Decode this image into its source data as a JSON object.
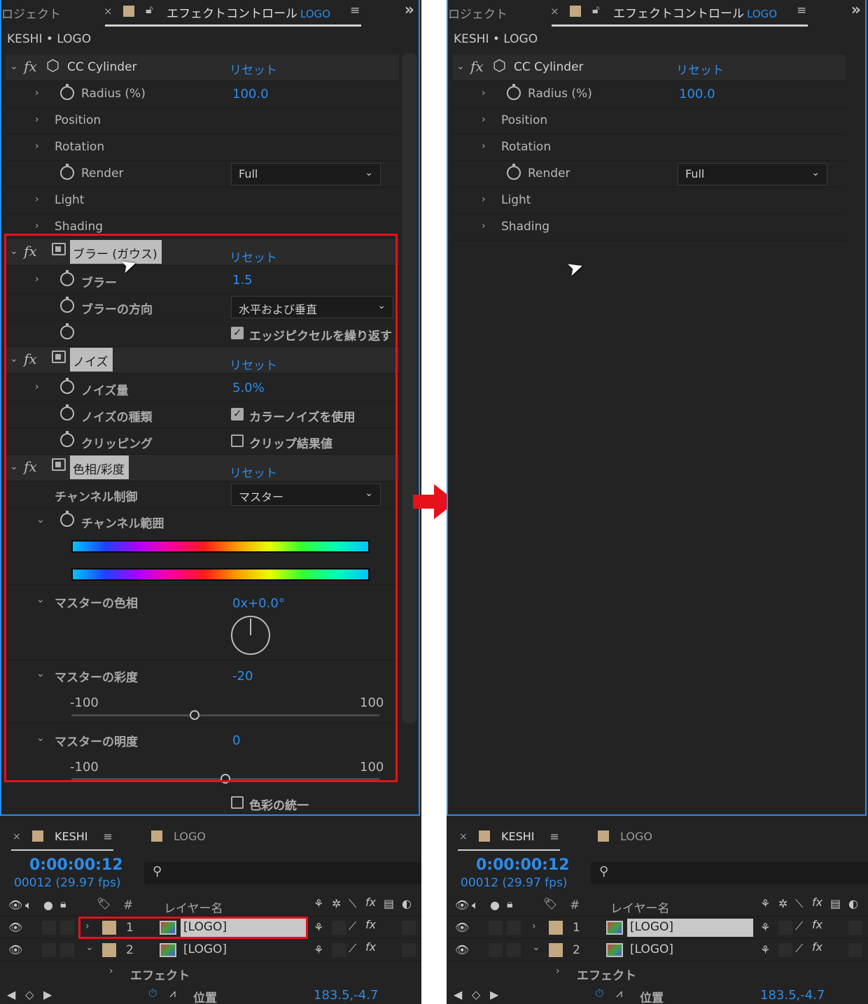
{
  "panels": {
    "left": {
      "tabs": {
        "project": "ロジェクト",
        "close": "×",
        "title": "エフェクトコントロール",
        "title_layer": "LOGO",
        "menu": "≡",
        "more": "»"
      },
      "comp_title": "KESHI • LOGO",
      "effects": {
        "cc_cylinder": {
          "name": "CC Cylinder",
          "reset": "リセット",
          "radius_label": "Radius (%)",
          "radius_value": "100.0",
          "position_label": "Position",
          "rotation_label": "Rotation",
          "render_label": "Render",
          "render_value": "Full",
          "light_label": "Light",
          "shading_label": "Shading"
        },
        "gaussian_blur": {
          "name": "ブラー (ガウス)",
          "reset": "リセット",
          "blur_label": "ブラー",
          "blur_value": "1.5",
          "direction_label": "ブラーの方向",
          "direction_value": "水平および垂直",
          "repeat_edge_label": "エッジピクセルを繰り返す",
          "repeat_edge_checked": true
        },
        "noise": {
          "name": "ノイズ",
          "reset": "リセット",
          "amount_label": "ノイズ量",
          "amount_value": "5.0%",
          "type_label": "ノイズの種類",
          "type_check_label": "カラーノイズを使用",
          "type_checked": true,
          "clipping_label": "クリッピング",
          "clipping_check_label": "クリップ結果値",
          "clipping_checked": false
        },
        "hue_saturation": {
          "name": "色相/彩度",
          "reset": "リセット",
          "channel_control_label": "チャンネル制御",
          "channel_control_value": "マスター",
          "channel_range_label": "チャンネル範囲",
          "master_hue_label": "マスターの色相",
          "master_hue_value": "0x+0.0°",
          "master_saturation_label": "マスターの彩度",
          "master_saturation_value": "-20",
          "master_saturation_min": "-100",
          "master_saturation_max": "100",
          "master_saturation_fraction": 0.4,
          "master_lightness_label": "マスターの明度",
          "master_lightness_value": "0",
          "master_lightness_min": "-100",
          "master_lightness_max": "100",
          "master_lightness_fraction": 0.5,
          "colorize_label": "色彩の統一",
          "colorize_checked": false
        }
      }
    },
    "right": {
      "tabs": {
        "project": "ロジェクト",
        "close": "×",
        "title": "エフェクトコントロール",
        "title_layer": "LOGO",
        "menu": "≡",
        "more": "»"
      },
      "comp_title": "KESHI • LOGO",
      "effects": {
        "cc_cylinder": {
          "name": "CC Cylinder",
          "reset": "リセット",
          "radius_label": "Radius (%)",
          "radius_value": "100.0",
          "position_label": "Position",
          "rotation_label": "Rotation",
          "render_label": "Render",
          "render_value": "Full",
          "light_label": "Light",
          "shading_label": "Shading"
        }
      }
    }
  },
  "timeline": {
    "close": "×",
    "tab_active": "KESHI",
    "tab_menu": "≡",
    "tab_other": "LOGO",
    "timecode": "0:00:00:12",
    "frames_fps": "00012 (29.97 fps)",
    "search_icon": "search-icon",
    "col_hash": "#",
    "col_layer_name": "レイヤー名",
    "layers": [
      {
        "num": "1",
        "name": "[LOGO]",
        "expanded": false
      },
      {
        "num": "2",
        "name": "[LOGO]",
        "expanded": true
      }
    ],
    "effect_group_label": "エフェクト",
    "position_label": "位置",
    "position_value": "183.5,-4.7"
  },
  "colors": {
    "accent": "#2d8ceb",
    "highlight_box": "#e8101a",
    "panel_bg": "#232323",
    "label_swatch": "#c4a882"
  }
}
